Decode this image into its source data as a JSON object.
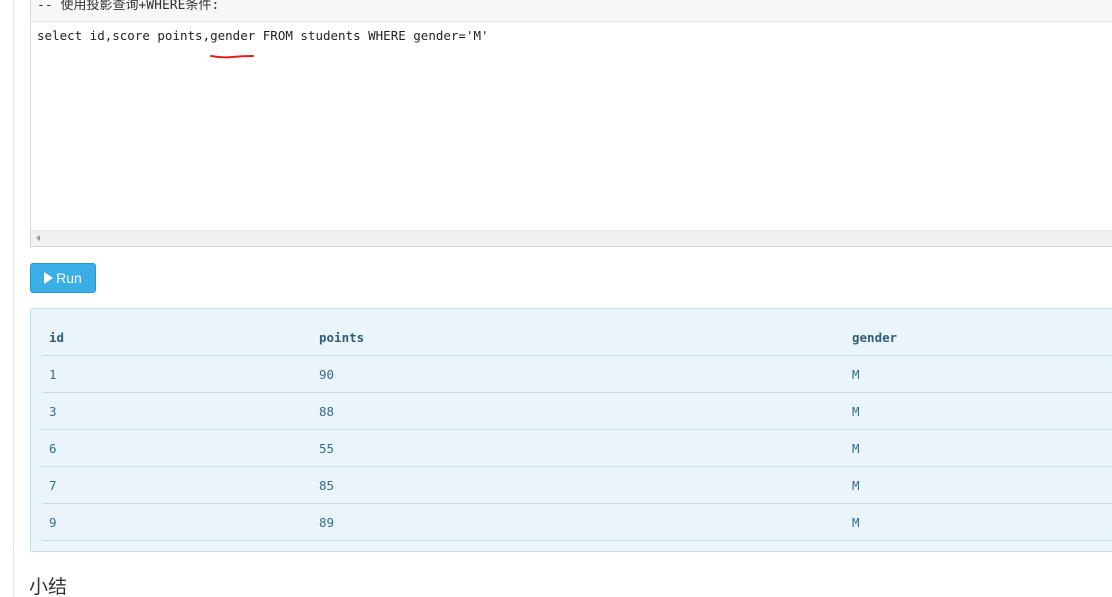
{
  "editor": {
    "comment": "-- 使用投影查询+WHERE条件:",
    "code": "select id,score points,gender FROM students WHERE gender='M'"
  },
  "run_button": {
    "label": "Run",
    "icon": "play-icon"
  },
  "result": {
    "columns": [
      "id",
      "points",
      "gender"
    ],
    "rows": [
      [
        "1",
        "90",
        "M"
      ],
      [
        "3",
        "88",
        "M"
      ],
      [
        "6",
        "55",
        "M"
      ],
      [
        "7",
        "85",
        "M"
      ],
      [
        "9",
        "89",
        "M"
      ]
    ]
  },
  "section": {
    "heading": "小结"
  },
  "colors": {
    "accent": "#3aaee6",
    "annotation": "#e02020",
    "panel_bg": "#eaf5fb"
  }
}
